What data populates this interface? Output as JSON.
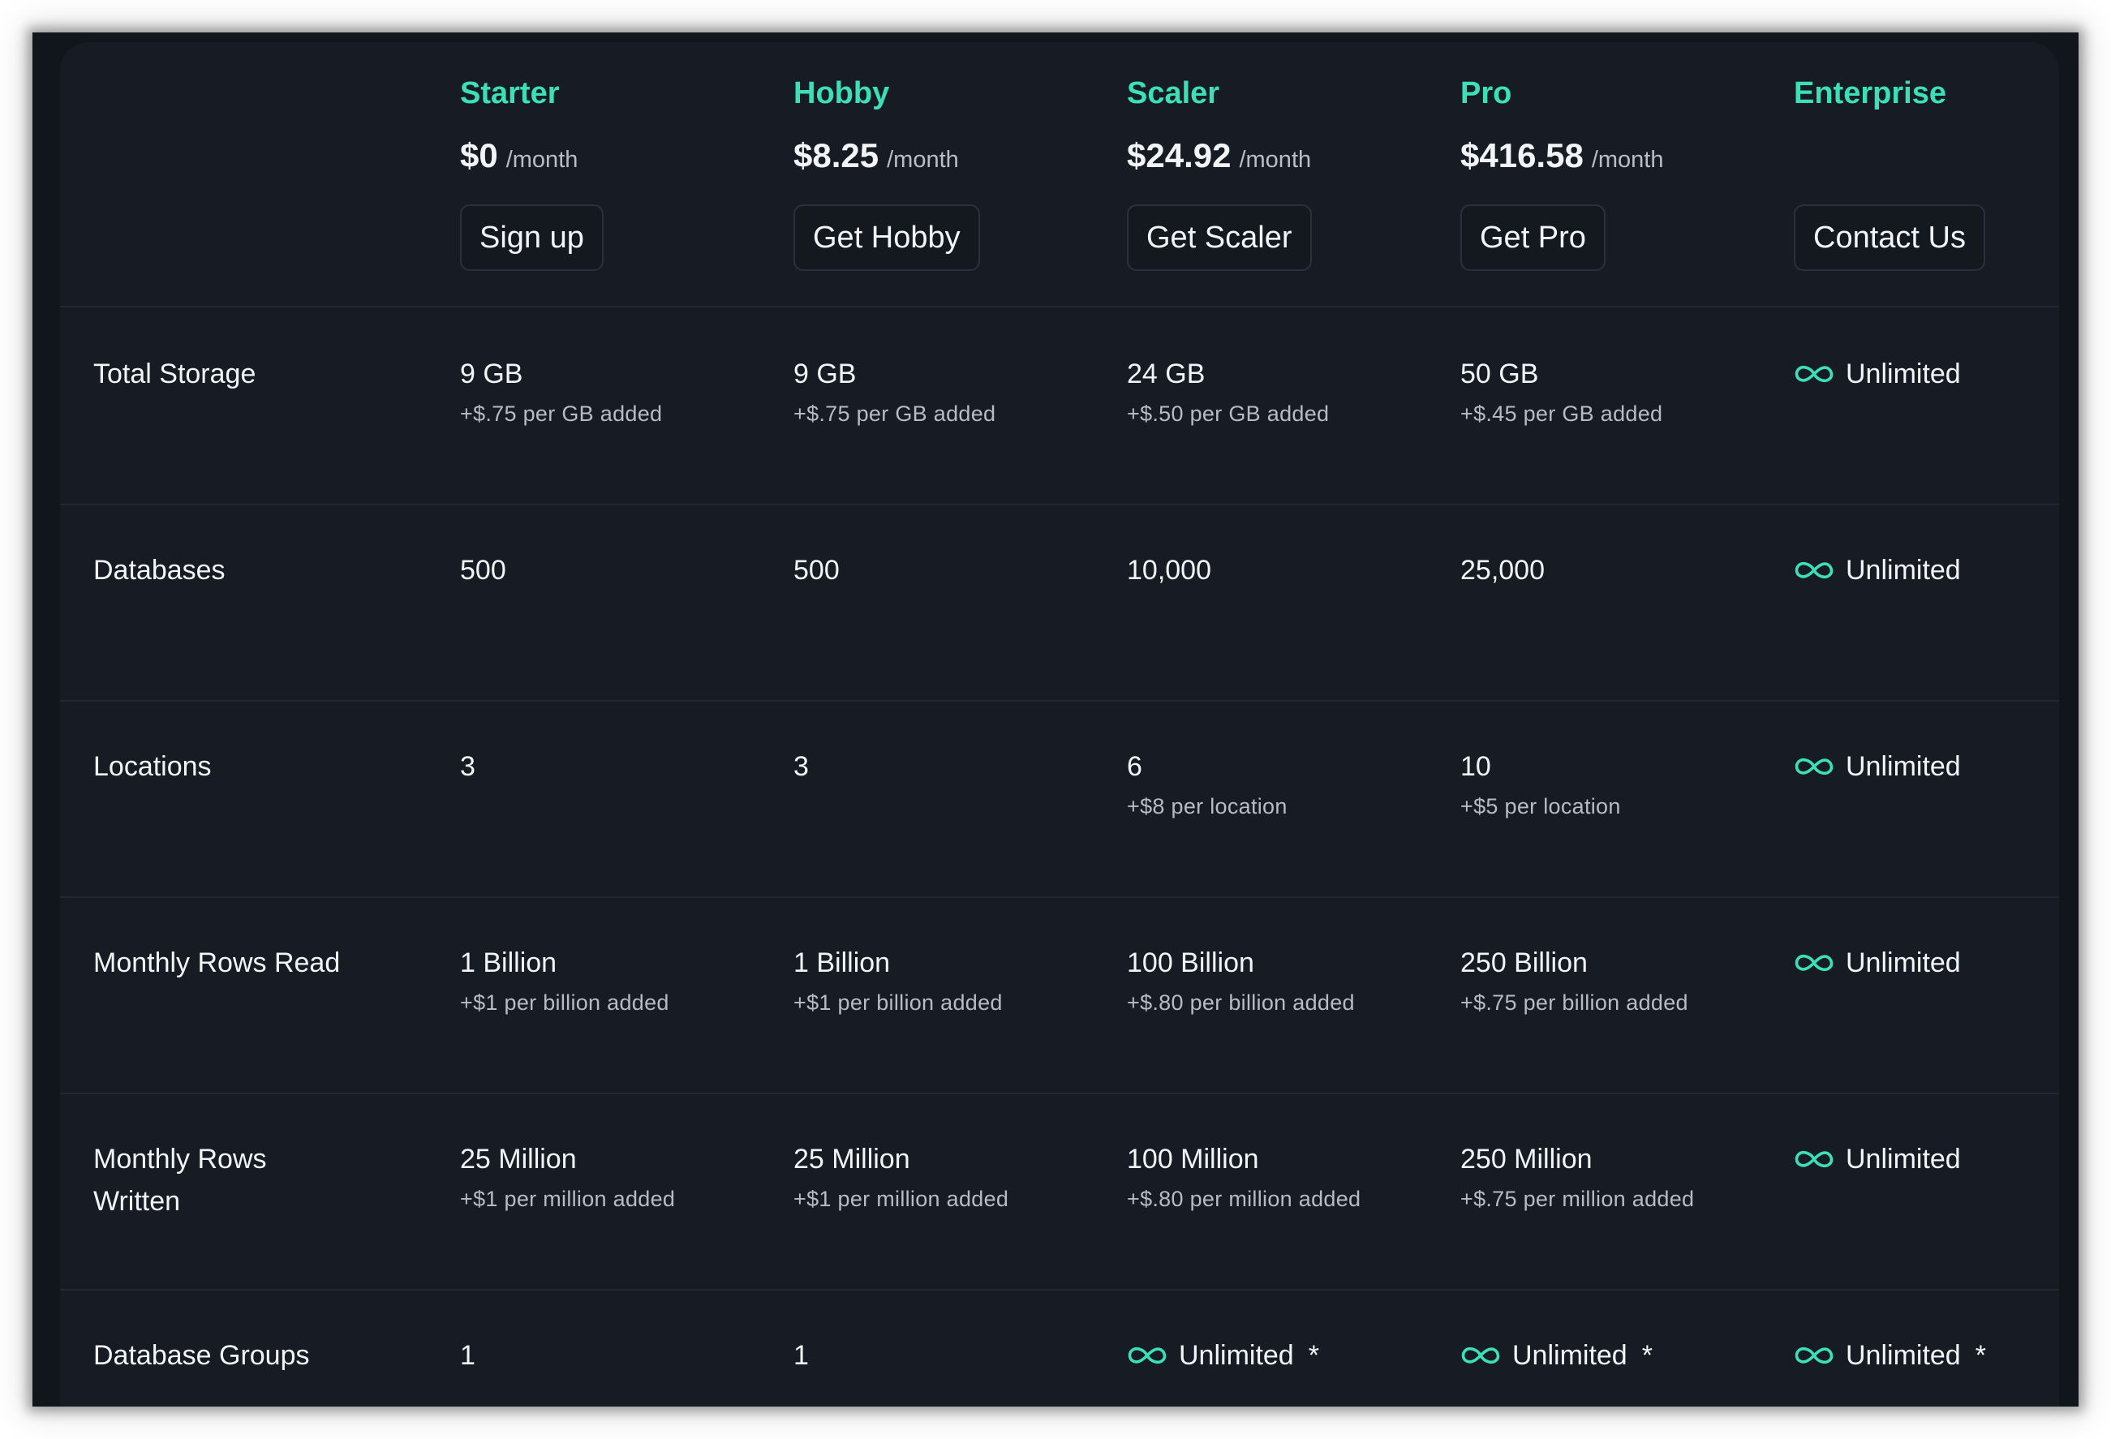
{
  "colors": {
    "accent": "#3ce0b8",
    "background": "#171c24",
    "text": "#f2f4f7",
    "muted": "#b6bcc6"
  },
  "plans": [
    {
      "name": "Starter",
      "price": "$0",
      "period": "/month",
      "button": "Sign up"
    },
    {
      "name": "Hobby",
      "price": "$8.25",
      "period": "/month",
      "button": "Get Hobby"
    },
    {
      "name": "Scaler",
      "price": "$24.92",
      "period": "/month",
      "button": "Get Scaler"
    },
    {
      "name": "Pro",
      "price": "$416.58",
      "period": "/month",
      "button": "Get Pro"
    },
    {
      "name": "Enterprise",
      "price": "",
      "period": "",
      "button": "Contact Us"
    }
  ],
  "features": [
    {
      "label": "Total Storage",
      "cells": [
        {
          "main": "9 GB",
          "sub": "+$.75 per GB added"
        },
        {
          "main": "9 GB",
          "sub": "+$.75 per GB added"
        },
        {
          "main": "24 GB",
          "sub": "+$.50 per GB added"
        },
        {
          "main": "50 GB",
          "sub": "+$.45 per GB added"
        },
        {
          "main": "Unlimited",
          "icon": "infinity-icon"
        }
      ]
    },
    {
      "label": "Databases",
      "cells": [
        {
          "main": "500"
        },
        {
          "main": "500"
        },
        {
          "main": "10,000"
        },
        {
          "main": "25,000"
        },
        {
          "main": "Unlimited",
          "icon": "infinity-icon"
        }
      ]
    },
    {
      "label": "Locations",
      "cells": [
        {
          "main": "3"
        },
        {
          "main": "3"
        },
        {
          "main": "6",
          "sub": "+$8 per location"
        },
        {
          "main": "10",
          "sub": "+$5 per location"
        },
        {
          "main": "Unlimited",
          "icon": "infinity-icon"
        }
      ]
    },
    {
      "label": "Monthly Rows Read",
      "cells": [
        {
          "main": "1 Billion",
          "sub": "+$1 per billion added"
        },
        {
          "main": "1 Billion",
          "sub": "+$1 per billion added"
        },
        {
          "main": "100 Billion",
          "sub": "+$.80 per billion added"
        },
        {
          "main": "250 Billion",
          "sub": "+$.75 per billion added"
        },
        {
          "main": "Unlimited",
          "icon": "infinity-icon"
        }
      ]
    },
    {
      "label": "Monthly Rows Written",
      "cells": [
        {
          "main": "25 Million",
          "sub": "+$1 per million added"
        },
        {
          "main": "25 Million",
          "sub": "+$1 per million added"
        },
        {
          "main": "100 Million",
          "sub": "+$.80 per million added"
        },
        {
          "main": "250 Million",
          "sub": "+$.75 per million added"
        },
        {
          "main": "Unlimited",
          "icon": "infinity-icon"
        }
      ]
    },
    {
      "label": "Database Groups",
      "cells": [
        {
          "main": "1"
        },
        {
          "main": "1"
        },
        {
          "main": "Unlimited",
          "icon": "infinity-icon",
          "suffix": "*"
        },
        {
          "main": "Unlimited",
          "icon": "infinity-icon",
          "suffix": "*"
        },
        {
          "main": "Unlimited",
          "icon": "infinity-icon",
          "suffix": "*"
        }
      ]
    }
  ]
}
